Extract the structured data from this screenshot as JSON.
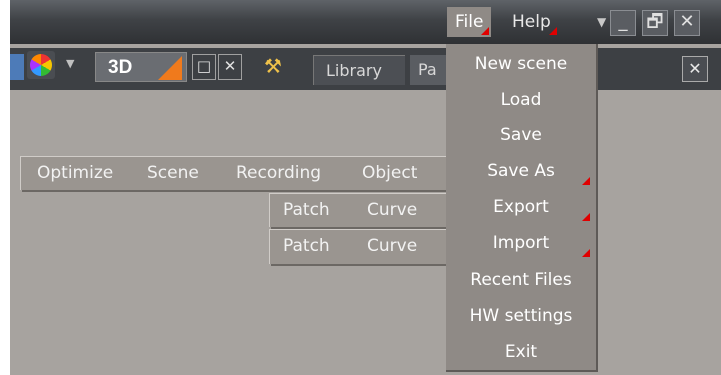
{
  "menubar": {
    "file": "File",
    "help": "Help"
  },
  "toolbar": {
    "mode": "3D",
    "tabs": [
      "Library",
      "Pa"
    ]
  },
  "left_menu": {
    "items": [
      "Optimize",
      "Scene",
      "Recording",
      "Object"
    ],
    "submenu1": [
      "Patch",
      "Curve"
    ],
    "submenu2": [
      "Patch",
      "Curve"
    ]
  },
  "file_menu": {
    "items": [
      {
        "label": "New scene",
        "has_submenu": false
      },
      {
        "label": "Load",
        "has_submenu": false
      },
      {
        "label": "Save",
        "has_submenu": false
      },
      {
        "label": "Save As",
        "has_submenu": true
      },
      {
        "label": "Export",
        "has_submenu": true
      },
      {
        "label": "Import",
        "has_submenu": true
      },
      {
        "label": "Recent Files",
        "has_submenu": false
      },
      {
        "label": "HW settings",
        "has_submenu": false
      },
      {
        "label": "Exit",
        "has_submenu": false
      }
    ]
  },
  "icons": {
    "minimize": "minimize-icon",
    "restore": "restore-icon",
    "close": "close-icon",
    "palette": "palette-icon",
    "tools": "tools-icon"
  },
  "colors": {
    "accent_red": "#e00000",
    "orange": "#f07a1c",
    "menu_bg": "#8f8a86",
    "workspace": "#a7a39f"
  }
}
